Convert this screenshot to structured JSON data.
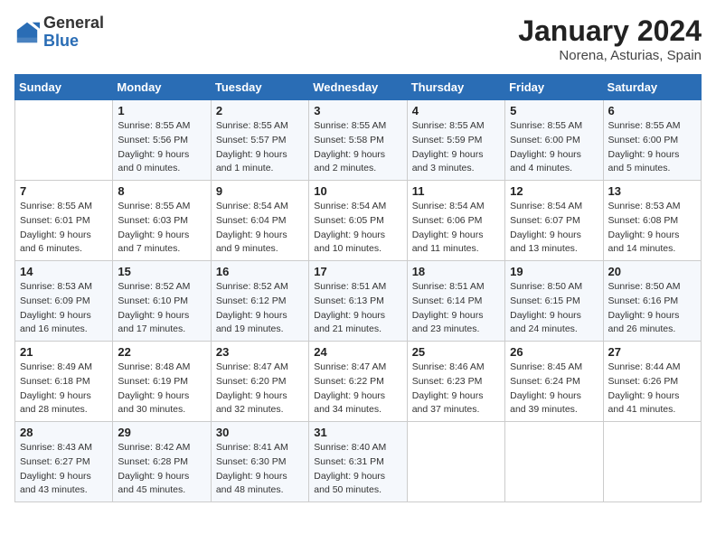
{
  "logo": {
    "text_general": "General",
    "text_blue": "Blue"
  },
  "header": {
    "month_year": "January 2024",
    "location": "Norena, Asturias, Spain"
  },
  "weekdays": [
    "Sunday",
    "Monday",
    "Tuesday",
    "Wednesday",
    "Thursday",
    "Friday",
    "Saturday"
  ],
  "weeks": [
    [
      {
        "day": "",
        "info": ""
      },
      {
        "day": "1",
        "info": "Sunrise: 8:55 AM\nSunset: 5:56 PM\nDaylight: 9 hours\nand 0 minutes."
      },
      {
        "day": "2",
        "info": "Sunrise: 8:55 AM\nSunset: 5:57 PM\nDaylight: 9 hours\nand 1 minute."
      },
      {
        "day": "3",
        "info": "Sunrise: 8:55 AM\nSunset: 5:58 PM\nDaylight: 9 hours\nand 2 minutes."
      },
      {
        "day": "4",
        "info": "Sunrise: 8:55 AM\nSunset: 5:59 PM\nDaylight: 9 hours\nand 3 minutes."
      },
      {
        "day": "5",
        "info": "Sunrise: 8:55 AM\nSunset: 6:00 PM\nDaylight: 9 hours\nand 4 minutes."
      },
      {
        "day": "6",
        "info": "Sunrise: 8:55 AM\nSunset: 6:00 PM\nDaylight: 9 hours\nand 5 minutes."
      }
    ],
    [
      {
        "day": "7",
        "info": "Sunrise: 8:55 AM\nSunset: 6:01 PM\nDaylight: 9 hours\nand 6 minutes."
      },
      {
        "day": "8",
        "info": "Sunrise: 8:55 AM\nSunset: 6:03 PM\nDaylight: 9 hours\nand 7 minutes."
      },
      {
        "day": "9",
        "info": "Sunrise: 8:54 AM\nSunset: 6:04 PM\nDaylight: 9 hours\nand 9 minutes."
      },
      {
        "day": "10",
        "info": "Sunrise: 8:54 AM\nSunset: 6:05 PM\nDaylight: 9 hours\nand 10 minutes."
      },
      {
        "day": "11",
        "info": "Sunrise: 8:54 AM\nSunset: 6:06 PM\nDaylight: 9 hours\nand 11 minutes."
      },
      {
        "day": "12",
        "info": "Sunrise: 8:54 AM\nSunset: 6:07 PM\nDaylight: 9 hours\nand 13 minutes."
      },
      {
        "day": "13",
        "info": "Sunrise: 8:53 AM\nSunset: 6:08 PM\nDaylight: 9 hours\nand 14 minutes."
      }
    ],
    [
      {
        "day": "14",
        "info": "Sunrise: 8:53 AM\nSunset: 6:09 PM\nDaylight: 9 hours\nand 16 minutes."
      },
      {
        "day": "15",
        "info": "Sunrise: 8:52 AM\nSunset: 6:10 PM\nDaylight: 9 hours\nand 17 minutes."
      },
      {
        "day": "16",
        "info": "Sunrise: 8:52 AM\nSunset: 6:12 PM\nDaylight: 9 hours\nand 19 minutes."
      },
      {
        "day": "17",
        "info": "Sunrise: 8:51 AM\nSunset: 6:13 PM\nDaylight: 9 hours\nand 21 minutes."
      },
      {
        "day": "18",
        "info": "Sunrise: 8:51 AM\nSunset: 6:14 PM\nDaylight: 9 hours\nand 23 minutes."
      },
      {
        "day": "19",
        "info": "Sunrise: 8:50 AM\nSunset: 6:15 PM\nDaylight: 9 hours\nand 24 minutes."
      },
      {
        "day": "20",
        "info": "Sunrise: 8:50 AM\nSunset: 6:16 PM\nDaylight: 9 hours\nand 26 minutes."
      }
    ],
    [
      {
        "day": "21",
        "info": "Sunrise: 8:49 AM\nSunset: 6:18 PM\nDaylight: 9 hours\nand 28 minutes."
      },
      {
        "day": "22",
        "info": "Sunrise: 8:48 AM\nSunset: 6:19 PM\nDaylight: 9 hours\nand 30 minutes."
      },
      {
        "day": "23",
        "info": "Sunrise: 8:47 AM\nSunset: 6:20 PM\nDaylight: 9 hours\nand 32 minutes."
      },
      {
        "day": "24",
        "info": "Sunrise: 8:47 AM\nSunset: 6:22 PM\nDaylight: 9 hours\nand 34 minutes."
      },
      {
        "day": "25",
        "info": "Sunrise: 8:46 AM\nSunset: 6:23 PM\nDaylight: 9 hours\nand 37 minutes."
      },
      {
        "day": "26",
        "info": "Sunrise: 8:45 AM\nSunset: 6:24 PM\nDaylight: 9 hours\nand 39 minutes."
      },
      {
        "day": "27",
        "info": "Sunrise: 8:44 AM\nSunset: 6:26 PM\nDaylight: 9 hours\nand 41 minutes."
      }
    ],
    [
      {
        "day": "28",
        "info": "Sunrise: 8:43 AM\nSunset: 6:27 PM\nDaylight: 9 hours\nand 43 minutes."
      },
      {
        "day": "29",
        "info": "Sunrise: 8:42 AM\nSunset: 6:28 PM\nDaylight: 9 hours\nand 45 minutes."
      },
      {
        "day": "30",
        "info": "Sunrise: 8:41 AM\nSunset: 6:30 PM\nDaylight: 9 hours\nand 48 minutes."
      },
      {
        "day": "31",
        "info": "Sunrise: 8:40 AM\nSunset: 6:31 PM\nDaylight: 9 hours\nand 50 minutes."
      },
      {
        "day": "",
        "info": ""
      },
      {
        "day": "",
        "info": ""
      },
      {
        "day": "",
        "info": ""
      }
    ]
  ]
}
